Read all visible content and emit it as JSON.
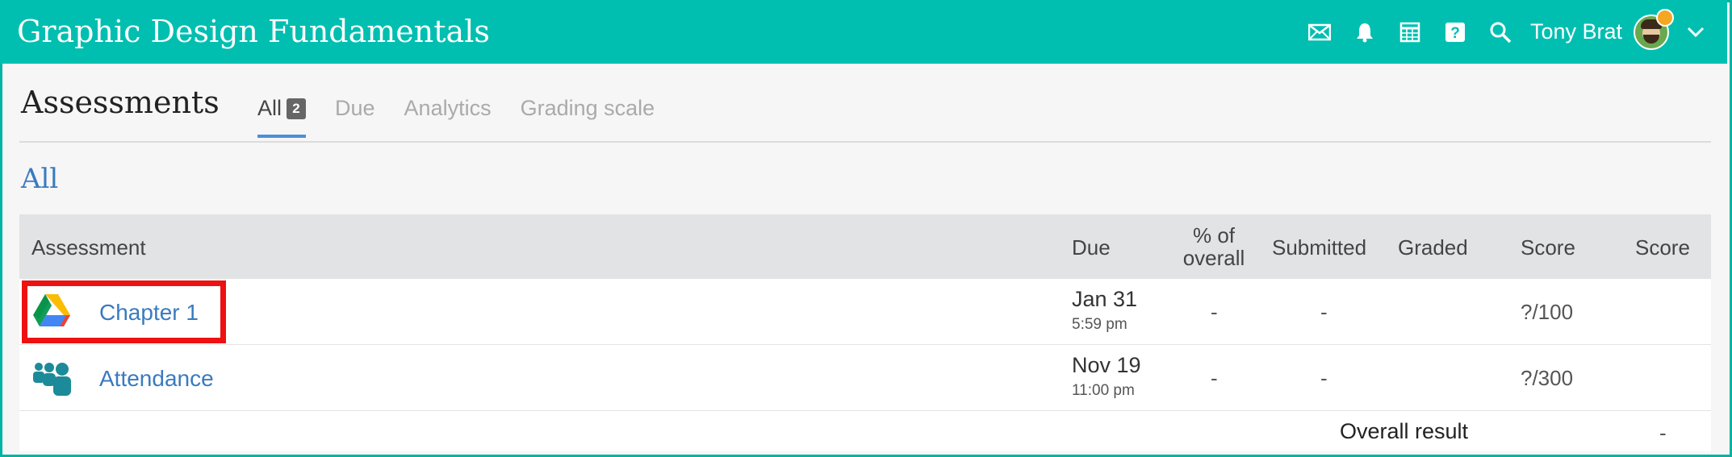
{
  "header": {
    "course_title": "Graphic Design Fundamentals",
    "user_name": "Tony Brat",
    "icons": [
      "mail-icon",
      "bell-icon",
      "calendar-icon",
      "help-icon",
      "search-icon",
      "chevron-down-icon"
    ],
    "bar_color": "#00bfb1"
  },
  "page": {
    "title": "Assessments",
    "tabs": [
      {
        "label": "All",
        "count": "2",
        "active": true
      },
      {
        "label": "Due",
        "active": false
      },
      {
        "label": "Analytics",
        "active": false
      },
      {
        "label": "Grading scale",
        "active": false
      }
    ],
    "section_title": "All"
  },
  "table": {
    "columns": [
      "Assessment",
      "Due",
      "% of overall",
      "Submitted",
      "Graded",
      "Score",
      "Score"
    ],
    "rows": [
      {
        "icon": "google-drive-icon",
        "name": "Chapter 1",
        "due_date": "Jan 31",
        "due_time": "5:59 pm",
        "percent_of_overall": "-",
        "submitted": "-",
        "graded": "",
        "score": "?/100",
        "score2": "",
        "highlighted": true
      },
      {
        "icon": "people-icon",
        "name": "Attendance",
        "due_date": "Nov 19",
        "due_time": "11:00 pm",
        "percent_of_overall": "-",
        "submitted": "-",
        "graded": "",
        "score": "?/300",
        "score2": "",
        "highlighted": false
      }
    ],
    "footer": {
      "label": "Overall result",
      "value": "-"
    }
  },
  "colors": {
    "accent": "#00bfb1",
    "link": "#3a7abf",
    "tab_underline": "#4a90d9",
    "highlight": "#ee1111"
  }
}
